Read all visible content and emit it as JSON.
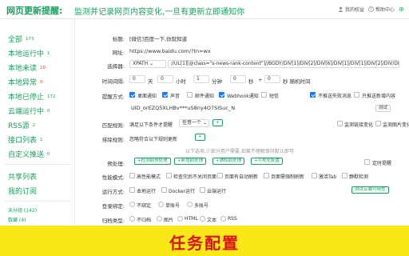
{
  "header": {
    "brand": "网页更新提醒:",
    "tagline": "监测并记录网页内容变化,一旦有更新立即通知你",
    "links": [
      "我的权益",
      "帮助中心"
    ]
  },
  "sidebar": {
    "items": [
      {
        "label": "全部",
        "count": "173"
      },
      {
        "label": "本地运行中",
        "count": "1"
      },
      {
        "label": "本地未读",
        "count": "10"
      },
      {
        "label": "本地异常",
        "count": "0"
      },
      {
        "label": "本地已停止",
        "count": "172"
      },
      {
        "label": "云端运行中",
        "count": "0"
      },
      {
        "label": "RSS源",
        "count": "2"
      },
      {
        "label": "接口列表",
        "count": "1"
      },
      {
        "label": "自定义推送",
        "count": "0"
      }
    ],
    "items2": [
      "共享列表",
      "我的订阅"
    ],
    "small": [
      "未分组 (142)",
      "数藏 (4)"
    ]
  },
  "form": {
    "title_label": "标题:",
    "title_value": "[微信]百度一下,你就知道",
    "url_label": "网址:",
    "url_value": "https://www.baidu.com/?tn=wx",
    "selector_label": "选择器:",
    "selector_type": "XPATH",
    "selector_value": "//UL[1][@class=\"s-news-rank-content\"]//BODY/DIV[1]/DIV[2]/DIV[6]/DIV[1]/DIV[1]/DIV[2]/DIV/DIV[1]",
    "interval_label": "时间间隔:",
    "interval": {
      "days": "0",
      "day_unit": "天",
      "hours": "0",
      "hour_unit": "小时",
      "minutes": "1",
      "minute_unit": "分钟",
      "seconds": "0",
      "second_unit": "秒",
      "random_prefix": "+",
      "random": "0",
      "random_unit": "秒 随机时间"
    },
    "notify_label": "提醒方式:",
    "notify_options": [
      "桌面通知",
      "声音",
      "邮件通知",
      "Webhook通知",
      "短信"
    ],
    "notify_extra": [
      "不推送失败消息",
      "只推送新增内容"
    ],
    "uid_value": "UID_orEZQ5XLHBv***uS8ny4O7SISuc_N",
    "test_btn": "测试",
    "match_label": "匹配规则:",
    "match_rule": "满足以下条件才提醒",
    "match_select": "任意一个",
    "match_extra": [
      "监测链接变化",
      "监测图片变化"
    ],
    "exclude_label": "排除规则:",
    "exclude_rule": "忽略符合以下规则更新",
    "section_hint": "以下选项,少部分用户需要,如果不理解保持默认即可",
    "preprocess_label": "预处理:",
    "preprocess_btns": [
      "+检测前预处理",
      "+新增前处理",
      "+通知前处理",
      "+可视化配置"
    ],
    "preprocess_extra": "定时提醒",
    "perf_label": "性能模式:",
    "perf_options": [
      "高性能模式",
      "检查完后不关闭页面",
      "页面有自动刷新",
      "页面需强制刷新",
      "激活Tab",
      "静默检测"
    ],
    "run_label": "运行方式:",
    "run_options": [
      "本地运行",
      "Docker运行",
      "云端运行"
    ],
    "run_btn": "测试云端可用性",
    "login_label": "登录绑定:",
    "login_options": [
      "不绑定",
      "单账号",
      "多账号"
    ],
    "archive_label": "归档类型:",
    "archive_options": [
      "不归档",
      "图片",
      "HTML",
      "文本",
      "RSS"
    ]
  },
  "banner": {
    "text": "任务配置"
  },
  "colors": {
    "brand": "#19a15f",
    "checkbox": "#1677ff",
    "banner_bg": "#f9e717",
    "banner_text": "#d91414"
  }
}
